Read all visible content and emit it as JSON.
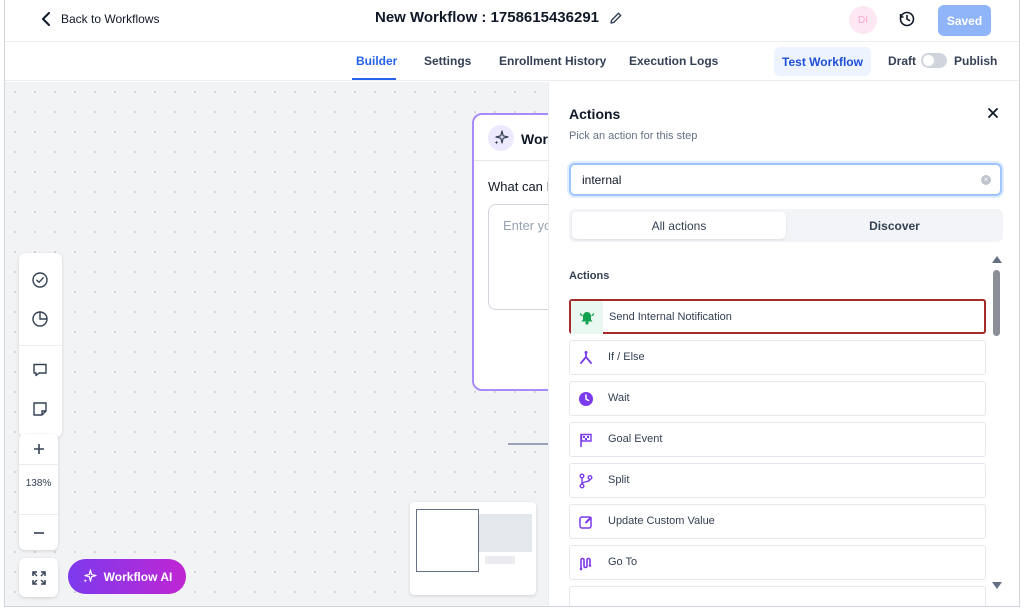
{
  "header": {
    "back_label": "Back to Workflows",
    "workflow_title": "New Workflow : 1758615436291",
    "avatar_initials": "DI",
    "saved_label": "Saved"
  },
  "tabs": [
    {
      "label": "Builder",
      "active": true
    },
    {
      "label": "Settings",
      "active": false
    },
    {
      "label": "Enrollment History",
      "active": false
    },
    {
      "label": "Execution Logs",
      "active": false
    }
  ],
  "toolbar": {
    "test_label": "Test Workflow",
    "draft_label": "Draft",
    "publish_label": "Publish",
    "publish_toggle": false
  },
  "canvas": {
    "ai_card_title": "Workflow AI",
    "ai_card_question": "What can I help you with?",
    "ai_card_placeholder": "Enter your prompt",
    "zoom_level": "138%",
    "ai_button_label": "Workflow AI"
  },
  "panel": {
    "title": "Actions",
    "subtitle": "Pick an action for this step",
    "search_value": "internal",
    "segments": [
      "All actions",
      "Discover"
    ],
    "section_label": "Actions",
    "items": [
      {
        "label": "Send Internal Notification",
        "icon": "bell-icon",
        "color": "#12a150"
      },
      {
        "label": "If / Else",
        "icon": "branch-icon",
        "color": "#7c3aed"
      },
      {
        "label": "Wait",
        "icon": "clock-icon",
        "color": "#7c3aed"
      },
      {
        "label": "Goal Event",
        "icon": "flag-icon",
        "color": "#7c3aed"
      },
      {
        "label": "Split",
        "icon": "split-icon",
        "color": "#7c3aed"
      },
      {
        "label": "Update Custom Value",
        "icon": "edit-icon",
        "color": "#7c3aed"
      },
      {
        "label": "Go To",
        "icon": "goto-icon",
        "color": "#7c3aed"
      }
    ]
  },
  "colors": {
    "accent": "#2563eb",
    "highlight_border": "#a52a2a",
    "ai_gradient": [
      "#7c3aed",
      "#c026d3"
    ]
  }
}
